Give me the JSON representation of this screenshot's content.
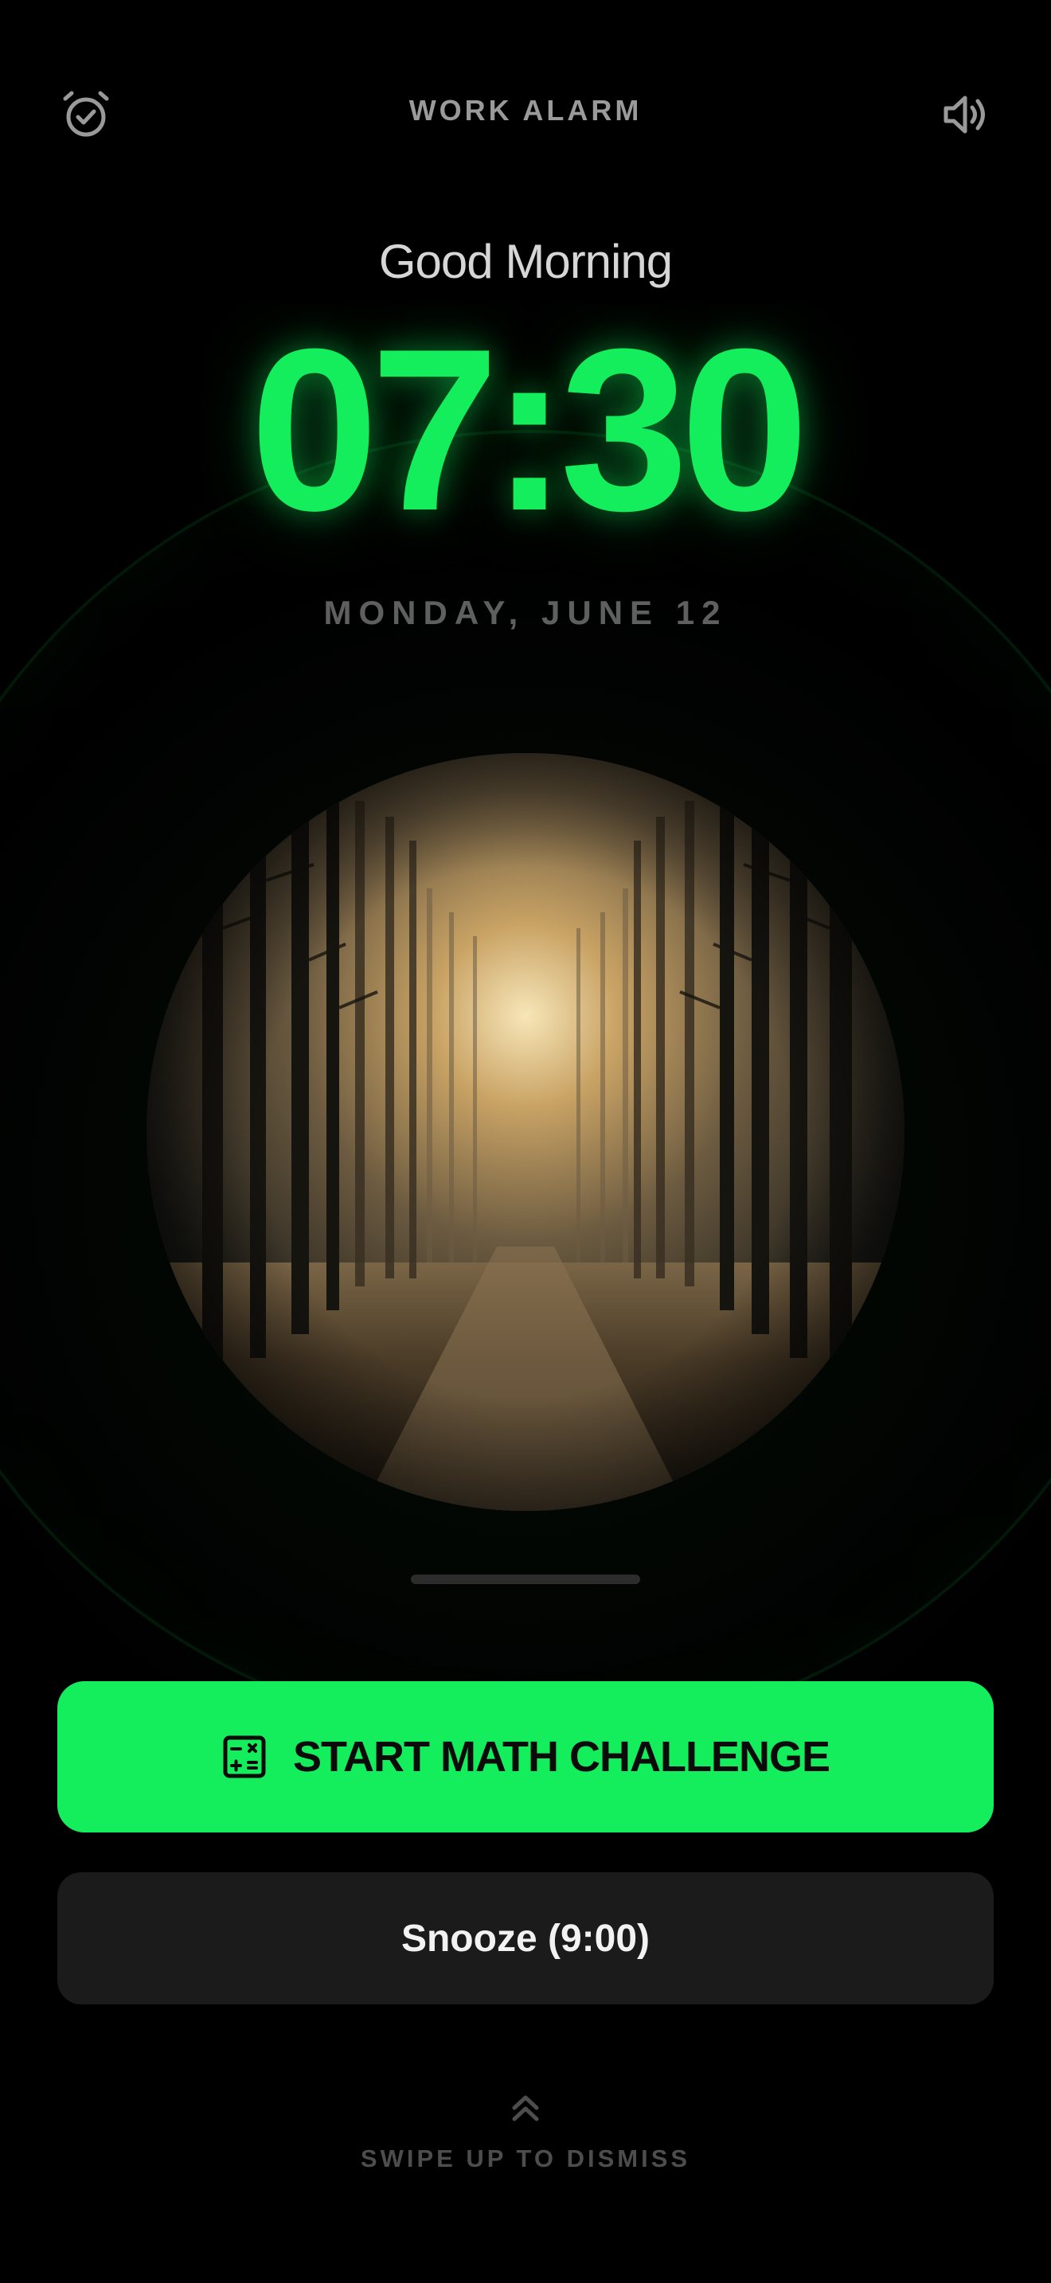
{
  "header": {
    "title": "WORK ALARM",
    "left_icon": "alarm-check-icon",
    "right_icon": "speaker-volume-icon"
  },
  "alarm": {
    "greeting": "Good Morning",
    "time": "07:30",
    "date": "MONDAY, JUNE 12"
  },
  "image": {
    "subject": "misty pine forest path at sunrise"
  },
  "actions": {
    "primary_label": "START MATH CHALLENGE",
    "primary_icon": "calculator-icon",
    "secondary_label": "Snooze (9:00)",
    "dismiss_icon": "chevrons-up-icon",
    "dismiss_label": "SWIPE UP TO DISMISS"
  },
  "colors": {
    "accent": "#15ee5c",
    "background": "#000000",
    "secondary_button": "#1b1b1b"
  }
}
